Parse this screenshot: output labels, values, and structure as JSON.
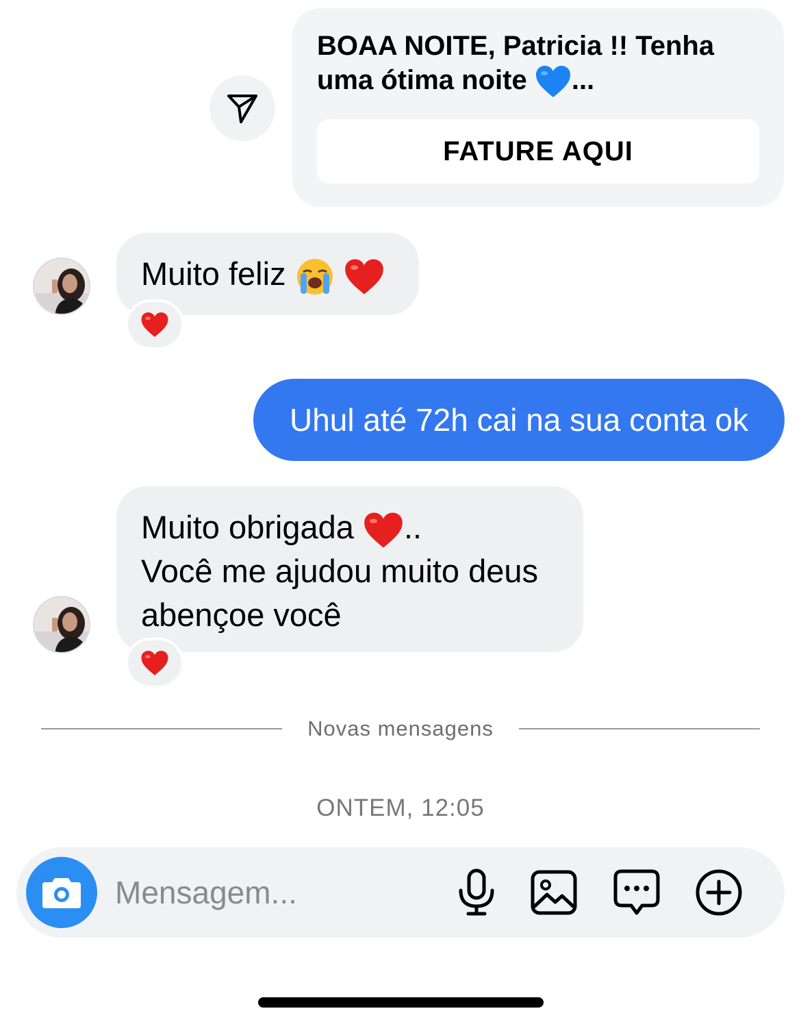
{
  "card_message": {
    "text": "BOAA NOITE, Patricia !! Tenha uma ótima noite",
    "emoji": "blue-heart",
    "suffix": "...",
    "button_label": "FATURE AQUI"
  },
  "messages": [
    {
      "direction": "incoming",
      "text": "Muito feliz",
      "emojis": [
        "loudly-crying-face",
        "red-heart"
      ],
      "reaction": "red-heart"
    },
    {
      "direction": "outgoing",
      "text": "Uhul até 72h cai na sua conta ok"
    },
    {
      "direction": "incoming",
      "line1": "Muito obrigada",
      "line1_suffix": "..",
      "line2": "Você me ajudou muito deus abençoe você",
      "emojis": [
        "red-heart"
      ],
      "reaction": "red-heart"
    }
  ],
  "divider": {
    "label": "Novas mensagens"
  },
  "timestamp": "ONTEM, 12:05",
  "composer": {
    "placeholder": "Mensagem...",
    "icons": [
      "camera-icon",
      "microphone-icon",
      "gallery-icon",
      "sticker-chat-icon",
      "plus-icon"
    ]
  },
  "colors": {
    "outgoing_bubble": "#3478f0",
    "incoming_bubble": "#eff0f2",
    "camera_button": "#2a8ef2"
  }
}
